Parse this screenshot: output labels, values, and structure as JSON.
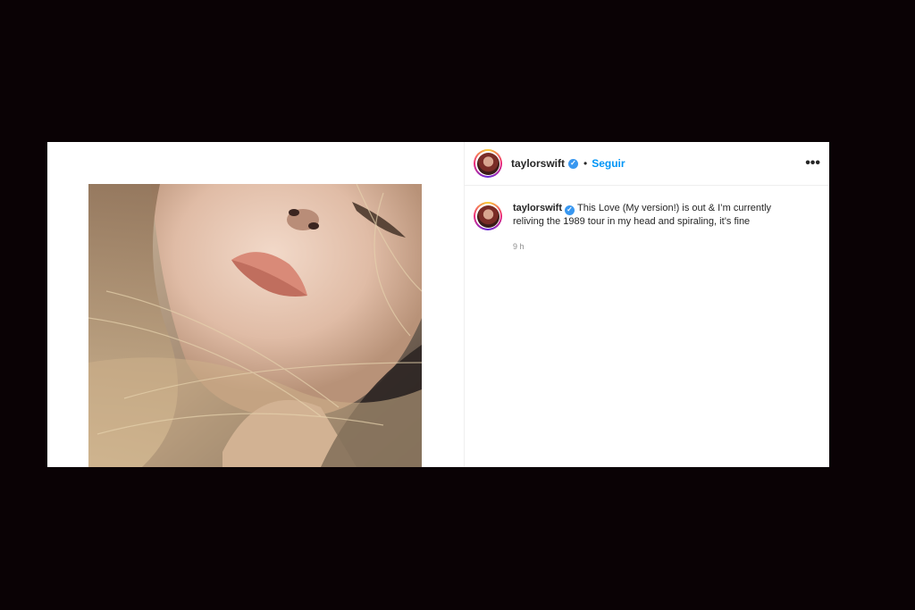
{
  "post": {
    "username": "taylorswift",
    "verified_icon": "verified-badge-icon",
    "separator": "•",
    "follow_label": "Seguir",
    "more_icon_glyph": "•••",
    "caption": "This Love (My version!) is out & I’m currently reliving the 1989 tour in my head and spiraling, it’s fine",
    "time_ago": "9 h"
  },
  "colors": {
    "background": "#0a0205",
    "follow": "#0095f6",
    "verified": "#3897f0"
  }
}
